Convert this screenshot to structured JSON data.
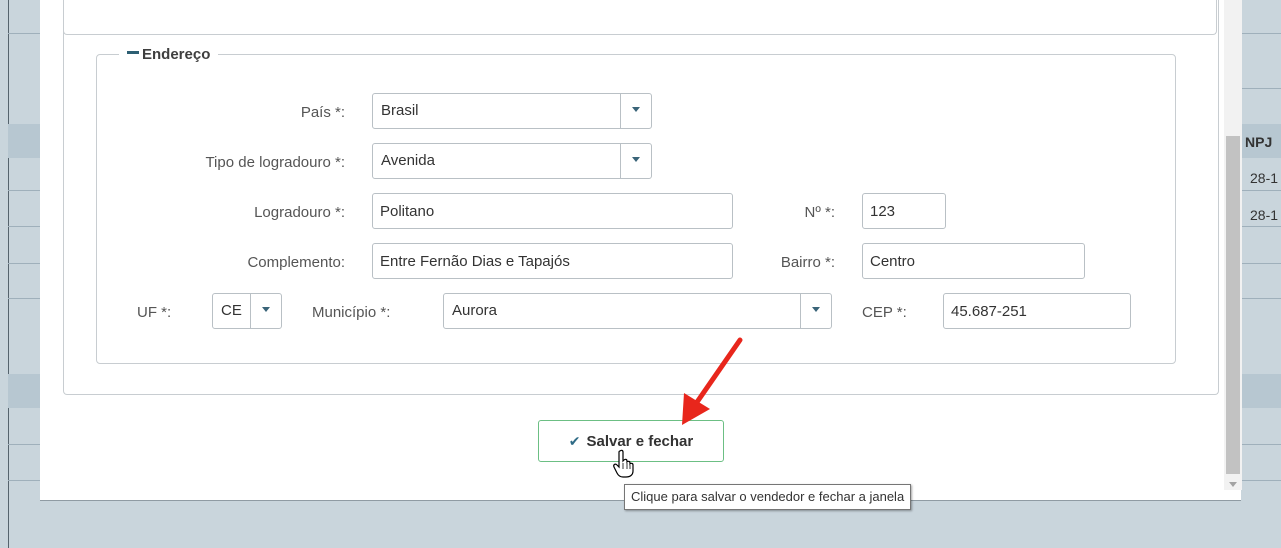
{
  "section": {
    "title": "Endereço"
  },
  "form": {
    "pais": {
      "label": "País *:",
      "value": "Brasil"
    },
    "tipo_logradouro": {
      "label": "Tipo de logradouro *:",
      "value": "Avenida"
    },
    "logradouro": {
      "label": "Logradouro *:",
      "value": "Politano"
    },
    "numero": {
      "label": "Nº *:",
      "value": "123"
    },
    "complemento": {
      "label": "Complemento:",
      "value": "Entre Fernão Dias e Tapajós"
    },
    "bairro": {
      "label": "Bairro *:",
      "value": "Centro"
    },
    "uf": {
      "label": "UF *:",
      "value": "CE"
    },
    "municipio": {
      "label": "Município *:",
      "value": "Aurora"
    },
    "cep": {
      "label": "CEP *:",
      "value": "45.687-251"
    }
  },
  "actions": {
    "save_label": "Salvar e fechar",
    "save_icon": "check-icon"
  },
  "tooltip": {
    "text": "Clique para salvar o vendedor e fechar a janela"
  },
  "background": {
    "column_header": "NPJ",
    "cells": [
      "28-1",
      "28-1"
    ]
  },
  "colors": {
    "accent": "#2d5f73",
    "save_border": "#6cbf84",
    "arrow": "#e8261c"
  }
}
